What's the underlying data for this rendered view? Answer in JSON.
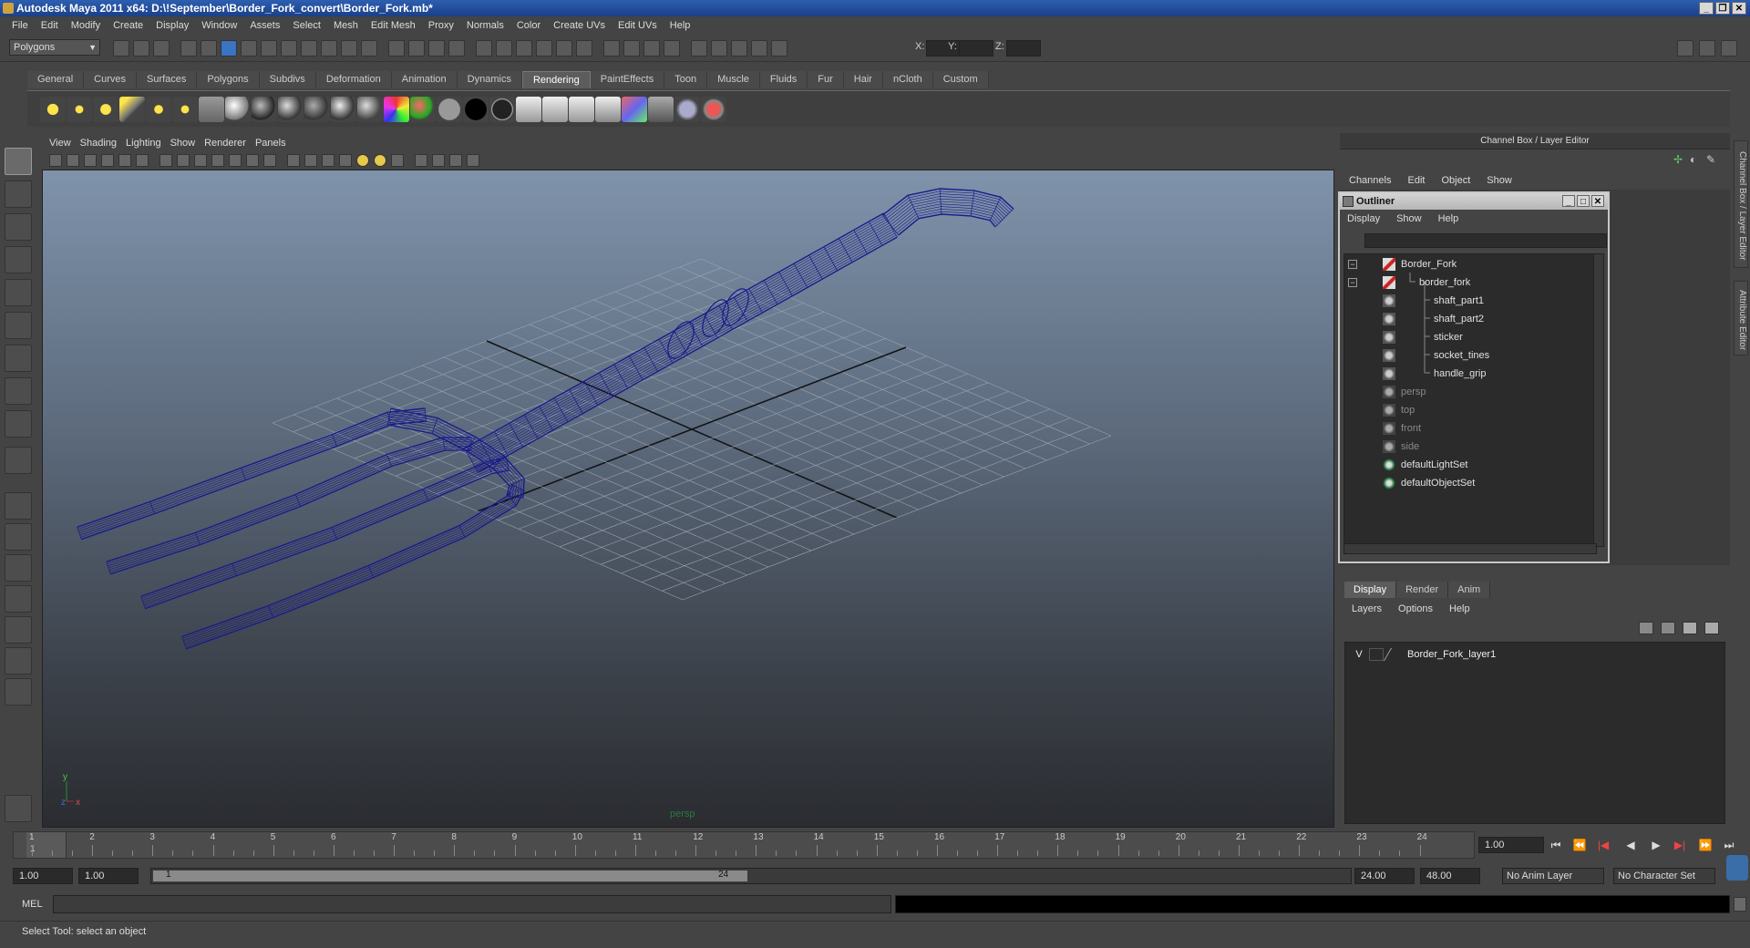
{
  "window": {
    "title": "Autodesk Maya 2011 x64: D:\\!September\\Border_Fork_convert\\Border_Fork.mb*"
  },
  "menubar": [
    "File",
    "Edit",
    "Modify",
    "Create",
    "Display",
    "Window",
    "Assets",
    "Select",
    "Mesh",
    "Edit Mesh",
    "Proxy",
    "Normals",
    "Color",
    "Create UVs",
    "Edit UVs",
    "Help"
  ],
  "statusline": {
    "mode": "Polygons",
    "x_label": "X:",
    "y_label": "Y:",
    "z_label": "Z:"
  },
  "shelf_tabs": [
    "General",
    "Curves",
    "Surfaces",
    "Polygons",
    "Subdivs",
    "Deformation",
    "Animation",
    "Dynamics",
    "Rendering",
    "PaintEffects",
    "Toon",
    "Muscle",
    "Fluids",
    "Fur",
    "Hair",
    "nCloth",
    "Custom"
  ],
  "shelf_active": "Rendering",
  "viewport": {
    "menu": [
      "View",
      "Shading",
      "Lighting",
      "Show",
      "Renderer",
      "Panels"
    ],
    "camera": "persp",
    "axis_y": "y",
    "axis_x": "x",
    "axis_z": "z",
    "wire_color": "#1a1a8c"
  },
  "channelbox": {
    "title": "Channel Box / Layer Editor",
    "menu": [
      "Channels",
      "Edit",
      "Object",
      "Show"
    ]
  },
  "outliner": {
    "title": "Outliner",
    "menu": [
      "Display",
      "Show",
      "Help"
    ],
    "items": [
      {
        "label": "Border_Fork",
        "depth": 0,
        "type": "group",
        "expand": "−"
      },
      {
        "label": "border_fork",
        "depth": 1,
        "type": "group",
        "expand": "−"
      },
      {
        "label": "shaft_part1",
        "depth": 2,
        "type": "mesh"
      },
      {
        "label": "shaft_part2",
        "depth": 2,
        "type": "mesh"
      },
      {
        "label": "sticker",
        "depth": 2,
        "type": "mesh"
      },
      {
        "label": "socket_tines",
        "depth": 2,
        "type": "mesh"
      },
      {
        "label": "handle_grip",
        "depth": 2,
        "type": "mesh"
      },
      {
        "label": "persp",
        "depth": 0,
        "type": "camera"
      },
      {
        "label": "top",
        "depth": 0,
        "type": "camera"
      },
      {
        "label": "front",
        "depth": 0,
        "type": "camera"
      },
      {
        "label": "side",
        "depth": 0,
        "type": "camera"
      },
      {
        "label": "defaultLightSet",
        "depth": 0,
        "type": "set"
      },
      {
        "label": "defaultObjectSet",
        "depth": 0,
        "type": "set"
      }
    ]
  },
  "layer_editor": {
    "tabs": [
      "Display",
      "Render",
      "Anim"
    ],
    "active_tab": "Display",
    "menu": [
      "Layers",
      "Options",
      "Help"
    ],
    "layers": [
      {
        "visible": "V",
        "name": "Border_Fork_layer1"
      }
    ]
  },
  "side_tabs": [
    "Channel Box / Layer Editor",
    "Attribute Editor"
  ],
  "timeline": {
    "ticks": [
      "1",
      "2",
      "3",
      "4",
      "5",
      "6",
      "7",
      "8",
      "9",
      "10",
      "11",
      "12",
      "13",
      "14",
      "15",
      "16",
      "17",
      "18",
      "19",
      "20",
      "21",
      "22",
      "23",
      "24"
    ],
    "current_marker": "1",
    "current_frame": "1.00"
  },
  "range": {
    "start": "1.00",
    "playback_start": "1.00",
    "range_lo": "1",
    "range_hi": "24",
    "playback_end": "24.00",
    "end": "48.00",
    "anim_layer": "No Anim Layer",
    "character_set": "No Character Set"
  },
  "cmdline": {
    "label": "MEL"
  },
  "helpline": "Select Tool: select an object"
}
